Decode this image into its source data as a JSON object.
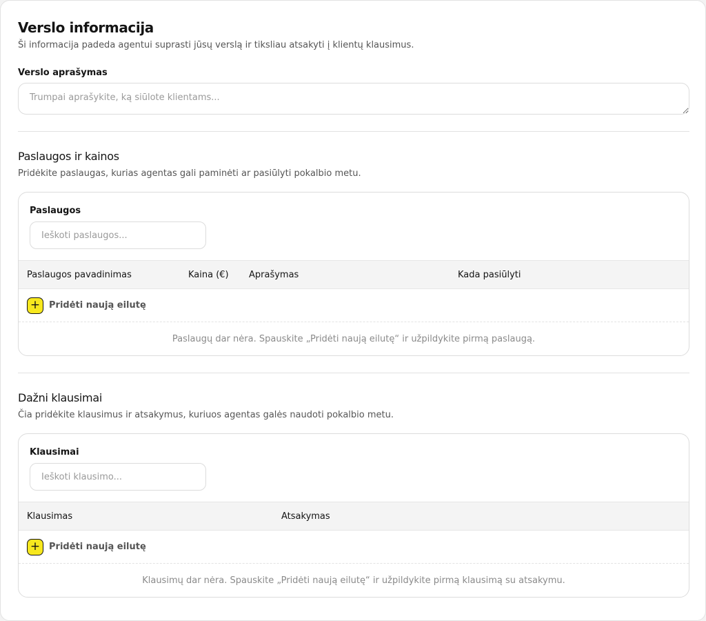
{
  "page": {
    "title": "Verslo informacija",
    "subtitle": "Ši informacija padeda agentui suprasti jūsų verslą ir tiksliau atsakyti į klientų klausimus."
  },
  "business_description": {
    "label": "Verslo aprašymas",
    "placeholder": "Trumpai aprašykite, ką siūlote klientams...",
    "value": ""
  },
  "services": {
    "title": "Paslaugos ir kainos",
    "subtitle": "Pridėkite paslaugas, kurias agentas gali paminėti ar pasiūlyti pokalbio metu.",
    "panel_label": "Paslaugos",
    "search_placeholder": "Ieškoti paslaugos...",
    "columns": [
      "Paslaugos pavadinimas",
      "Kaina (€)",
      "Aprašymas",
      "Kada pasiūlyti"
    ],
    "add_row_label": "Pridėti naują eilutę",
    "rows": [],
    "empty_text": "Paslaugų dar nėra. Spauskite „Pridėti naują eilutę“ ir užpildykite pirmą paslaugą."
  },
  "faq": {
    "title": "Dažni klausimai",
    "subtitle": "Čia pridėkite klausimus ir atsakymus, kuriuos agentas galės naudoti pokalbio metu.",
    "panel_label": "Klausimai",
    "search_placeholder": "Ieškoti klausimo...",
    "columns": [
      "Klausimas",
      "Atsakymas"
    ],
    "add_row_label": "Pridėti naują eilutę",
    "rows": [],
    "empty_text": "Klausimų dar nėra. Spauskite „Pridėti naują eilutę“ ir užpildykite pirmą klausimą su atsakymu."
  },
  "icons": {
    "add_row": "plus-icon",
    "textarea_resize": "resize-handle-icon"
  },
  "colors": {
    "accent": "#f7e81e",
    "table_header_bg": "#f4f4f4",
    "border": "#dcdcdc",
    "muted_text": "#8a8a8a"
  }
}
